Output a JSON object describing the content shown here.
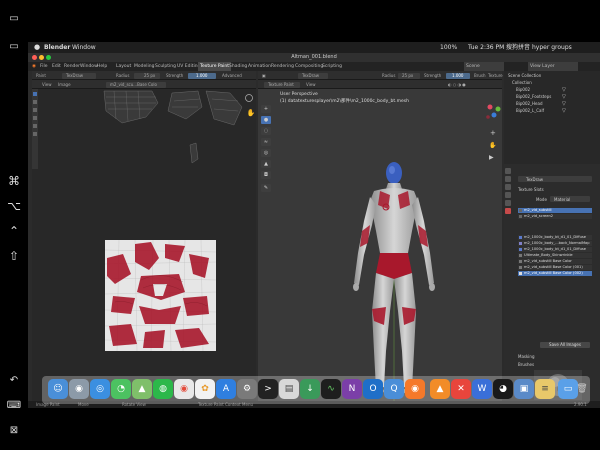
{
  "menubar": {
    "apple_icon": "apple-icon",
    "app_name": "Blender",
    "menu": "Window",
    "status_right": "Tue 2:36 PM",
    "battery": "100%",
    "user": "hyper groups",
    "input_method": "搜狗拼音"
  },
  "window": {
    "title": "Altman_001.blend"
  },
  "topbar": {
    "menus": [
      "File",
      "Edit",
      "Render",
      "Window",
      "Help"
    ],
    "workspaces": [
      "Layout",
      "Modeling",
      "Sculpting",
      "UV Editing",
      "Texture Paint",
      "Shading",
      "Animation",
      "Rendering",
      "Compositing",
      "Scripting"
    ],
    "active_workspace": "Texture Paint",
    "scene": "Scene",
    "view_layer": "View Layer"
  },
  "image_editor": {
    "mode": "Paint",
    "brush": "TexDraw",
    "radius_label": "Radius",
    "radius_value": "25 px",
    "strength_label": "Strength",
    "strength_value": "1.000",
    "advanced": "Advanced",
    "view_menu": "View",
    "image_menu": "Image",
    "image_name": "m2_vid_scu...Base Colo",
    "status": "Image Paint"
  },
  "viewport": {
    "mode": "Texture Paint",
    "view_menu": "View",
    "brush": "TexDraw",
    "radius_label": "Radius",
    "radius_value": "25 px",
    "strength_label": "Strength",
    "strength_value": "1.000",
    "brush_label": "Brush",
    "texture_label": "Texture",
    "perspective": "User Perspective",
    "object_info": "(1) datatexturesplayer\\m2\\那件\\m2_1000c_body_bt.mesh",
    "context_menu": "Texture Paint Context Menu"
  },
  "outliner": {
    "title": "Scene Collection",
    "items": [
      "Collection",
      "Bip002",
      "Bip002_Footsteps",
      "Bip002_Head",
      "Bip002_L_Calf"
    ]
  },
  "properties": {
    "brush_name": "TexDraw",
    "texture_slots_label": "Texture Slots",
    "mode_label": "Mode",
    "mode_value": "Material",
    "materials": [
      "m2_vid_substill",
      "m2_vid_screen2"
    ],
    "slots": [
      "m2_1000c_body_bt_d1_01_Diffuse",
      "m2_1000c_body_...back_NormalMap",
      "m2_1000c_body_bt_d1_01_Diffuse",
      "Ultimate_Body_Skinwrinkle",
      "m2_vid_substill Base Color",
      "m2_vid_substill Base Color (001)",
      "m2_vid_substill Base Color (002)"
    ],
    "selected_slot": 6,
    "save_button": "Save All Images",
    "masking_label": "Masking",
    "brushes_label": "Brushes"
  },
  "statusbar": {
    "left": "Image Paint",
    "middle": "Move",
    "mid2": "Rotate View",
    "right_hint": "Texture Paint Context Menu",
    "version": "2.90.1"
  },
  "dock": {
    "apps": [
      "finder-icon",
      "launchpad-icon",
      "safari-icon",
      "messages-icon",
      "maps-icon",
      "wechat-icon",
      "chrome-icon",
      "photos-icon",
      "app-store-icon",
      "system-preferences-icon",
      "terminal-icon",
      "file-icon",
      "download-icon",
      "activity-monitor-icon",
      "onenote-icon",
      "outlook-icon",
      "quicktime-icon",
      "blender-icon",
      "vlc-icon",
      "xmind-icon",
      "toolbox-icon",
      "wps-icon",
      "qq-icon",
      "preview-icon",
      "notes-icon",
      "folder-icon",
      "trash-icon"
    ]
  },
  "sidecar": {
    "command_glyph": "⌘",
    "option_glyph": "⌥",
    "caret_glyph": "⌃",
    "shift_glyph": "⇧"
  },
  "colors": {
    "accent": "#4772b3",
    "texture_red": "#a8182c",
    "figure_blue": "#3a5fbf"
  }
}
